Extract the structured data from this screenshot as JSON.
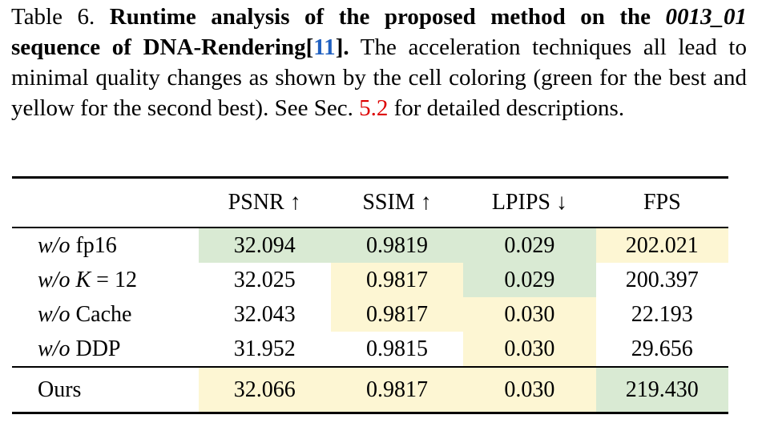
{
  "caption": {
    "prefix": "Table 6.",
    "title_part1": "Runtime analysis of the proposed method on the",
    "title_seq": "0013_01",
    "title_part2": "sequence of DNA-Rendering",
    "citation_open": "[",
    "citation_number": "11",
    "citation_close": "].",
    "body_part1": "The acceleration techniques all lead to minimal quality changes as shown by the cell coloring (green for the best and yellow for the second best). See Sec.",
    "section_ref": "5.2",
    "body_part2": "for detailed descriptions."
  },
  "table": {
    "columns": [
      {
        "label": "",
        "key": "method"
      },
      {
        "label": "PSNR ↑",
        "key": "psnr"
      },
      {
        "label": "SSIM ↑",
        "key": "ssim"
      },
      {
        "label": "LPIPS ↓",
        "key": "lpips"
      },
      {
        "label": "FPS",
        "key": "fps"
      }
    ],
    "rows": [
      {
        "label_italic": "w/o",
        "label_rest": " fp16",
        "psnr": "32.094",
        "ssim": "0.9819",
        "lpips": "0.029",
        "fps": "202.021",
        "hl": {
          "psnr": "green",
          "ssim": "green",
          "lpips": "green",
          "fps": "yellow"
        }
      },
      {
        "label_italic": "w/o",
        "label_math": " K",
        "label_rest": " = 12",
        "psnr": "32.025",
        "ssim": "0.9817",
        "lpips": "0.029",
        "fps": "200.397",
        "hl": {
          "psnr": "none",
          "ssim": "yellow",
          "lpips": "green",
          "fps": "none"
        }
      },
      {
        "label_italic": "w/o",
        "label_rest": " Cache",
        "psnr": "32.043",
        "ssim": "0.9817",
        "lpips": "0.030",
        "fps": "22.193",
        "hl": {
          "psnr": "none",
          "ssim": "yellow",
          "lpips": "yellow",
          "fps": "none"
        }
      },
      {
        "label_italic": "w/o",
        "label_rest": " DDP",
        "psnr": "31.952",
        "ssim": "0.9815",
        "lpips": "0.030",
        "fps": "29.656",
        "hl": {
          "psnr": "none",
          "ssim": "none",
          "lpips": "yellow",
          "fps": "none"
        }
      }
    ],
    "summary_row": {
      "label": "Ours",
      "psnr": "32.066",
      "ssim": "0.9817",
      "lpips": "0.030",
      "fps": "219.430",
      "hl": {
        "psnr": "yellow",
        "ssim": "yellow",
        "lpips": "yellow",
        "fps": "green"
      }
    }
  },
  "colors": {
    "best_green": "#d9ead3",
    "second_best_yellow": "#fdf6d3",
    "citation_blue": "#2060c0",
    "section_ref_red": "#dd0000",
    "rule_black": "#000000"
  }
}
